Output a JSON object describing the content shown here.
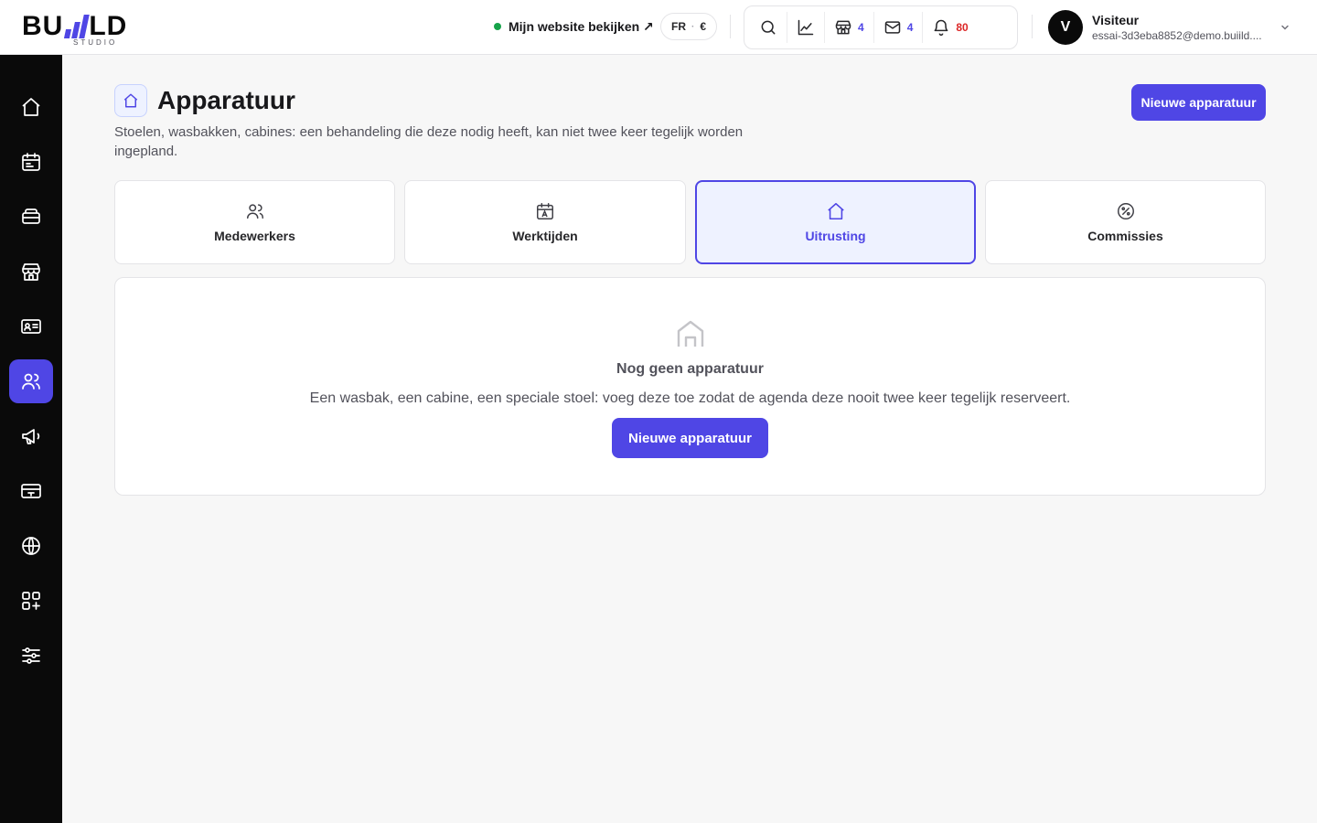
{
  "brand": {
    "logo_left": "BU",
    "logo_right": "LD",
    "logo_sub": "STUDIO"
  },
  "header": {
    "view_site_label": "Mijn website bekijken ↗",
    "locale_lang": "FR",
    "locale_sep": "·",
    "locale_currency": "€",
    "toolbar": {
      "stores_count": "4",
      "messages_count": "4",
      "notifications_count": "80"
    },
    "user": {
      "avatar_initial": "V",
      "name": "Visiteur",
      "email": "essai-3d3eba8852@demo.buiild...."
    }
  },
  "sidebar": {
    "items": [
      {
        "name": "home",
        "icon": "home-icon"
      },
      {
        "name": "calendar",
        "icon": "calendar-icon"
      },
      {
        "name": "services",
        "icon": "tray-icon"
      },
      {
        "name": "store",
        "icon": "store-icon"
      },
      {
        "name": "clients",
        "icon": "id-card-icon"
      },
      {
        "name": "team",
        "icon": "users-icon",
        "active": true
      },
      {
        "name": "marketing",
        "icon": "megaphone-icon"
      },
      {
        "name": "payments",
        "icon": "credit-card-icon"
      },
      {
        "name": "website",
        "icon": "globe-icon"
      },
      {
        "name": "apps",
        "icon": "apps-plus-icon"
      },
      {
        "name": "settings",
        "icon": "sliders-icon"
      }
    ]
  },
  "page": {
    "title": "Apparatuur",
    "description": "Stoelen, wasbakken, cabines: een behandeling die deze nodig heeft, kan niet twee keer tegelijk worden ingepland.",
    "new_button": "Nieuwe apparatuur"
  },
  "tabs": [
    {
      "label": "Medewerkers",
      "icon": "users-icon"
    },
    {
      "label": "Werktijden",
      "icon": "calendar-icon"
    },
    {
      "label": "Uitrusting",
      "icon": "home-icon",
      "active": true
    },
    {
      "label": "Commissies",
      "icon": "percent-icon"
    }
  ],
  "empty_state": {
    "icon": "house-outline-icon",
    "title": "Nog geen apparatuur",
    "text": "Een wasbak, een cabine, een speciale stoel: voeg deze toe zodat de agenda deze nooit twee keer tegelijk reserveert.",
    "button": "Nieuwe apparatuur"
  },
  "colors": {
    "accent": "#4f46e5",
    "sidebar_bg": "#0a0a0a",
    "status_online": "#16a34a",
    "notification_count": "#dc2626"
  }
}
